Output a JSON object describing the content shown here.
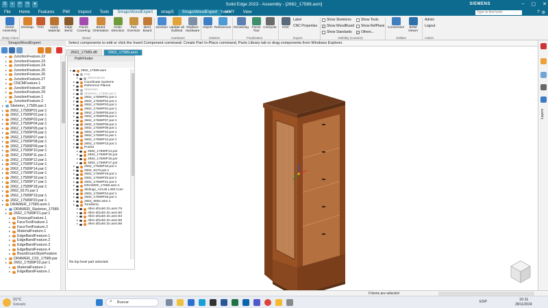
{
  "window": {
    "title": "Solid Edge 2023 - Assembly - [2662_17589.asm]",
    "brand": "SIEMENS",
    "controls": [
      "–",
      "▢",
      "✕"
    ]
  },
  "menu": {
    "tabs": [
      "File",
      "Home",
      "Features",
      "PMI",
      "Inspect",
      "Tools",
      "SmapsWoodExpert",
      "smapS",
      "SmapsWoodExpert",
      "HMY",
      "View"
    ],
    "active_index": 4,
    "token_label": "Token",
    "search_placeholder": "Type to find tools"
  },
  "ribbon": {
    "buttons": [
      {
        "label": "Clone Assembly",
        "icon": "clone-icon",
        "color": "#3a7bc8"
      },
      {
        "label": "Dressup",
        "icon": "dressup-icon",
        "color": "#d9822b"
      },
      {
        "label": "Trim",
        "icon": "trim-icon",
        "color": "#c65a2e"
      },
      {
        "label": "Apply Material",
        "icon": "material-icon",
        "color": "#b8742f"
      },
      {
        "label": "Edge Bend",
        "icon": "edge-bend-icon",
        "color": "#8b5a2b"
      },
      {
        "label": "Faces Covering",
        "icon": "faces-covering-icon",
        "color": "#a44bb0"
      },
      {
        "label": "Board Orientation",
        "icon": "board-orientation-icon",
        "color": "#d08a3a"
      },
      {
        "label": "Grain Direction",
        "icon": "grain-direction-icon",
        "color": "#6f9a3b"
      },
      {
        "label": "Part Oversize",
        "icon": "part-oversize-icon",
        "color": "#c9923e"
      },
      {
        "label": "Bent Board",
        "icon": "bent-board-icon",
        "color": "#c27a34"
      },
      {
        "label": "Junction",
        "icon": "junction-icon",
        "color": "#4a8ad0"
      },
      {
        "label": "Update all Subfeat",
        "icon": "update-icon",
        "color": "#e3a33a"
      },
      {
        "label": "Replace Hardware",
        "icon": "replace-hardware-icon",
        "color": "#7c8fa6"
      },
      {
        "label": "Import",
        "icon": "import-icon",
        "color": "#3c7fc4"
      },
      {
        "label": "References",
        "icon": "references-icon",
        "color": "#4d9ad6"
      },
      {
        "label": "Renaming",
        "icon": "renaming-icon",
        "color": "#5a7fb0"
      },
      {
        "label": "Faces Tool",
        "icon": "faces-tool-icon",
        "color": "#3d8f6c"
      },
      {
        "label": "Compute",
        "icon": "compute-icon",
        "color": "#6b6b6b"
      },
      {
        "label": "CNC",
        "icon": "cnc-icon",
        "color": "#5a6a7a"
      },
      {
        "label": "Conversion",
        "icon": "conversion-icon",
        "color": "#3f7fbf"
      },
      {
        "label": "BOM Viewer",
        "icon": "bom-viewer-icon",
        "color": "#2f6fab"
      }
    ],
    "groups": [
      "Deep Clone",
      "Wood",
      "Hardware",
      "HMSize",
      "Finalization",
      "Export",
      "Visibility (Custom)",
      "Utilities",
      "Admin"
    ],
    "export_items": [
      "Label",
      "CNC Properties"
    ],
    "checkboxes": [
      {
        "label": "Show Skeletons",
        "checked": false
      },
      {
        "label": "Show WoodBoard",
        "checked": true
      },
      {
        "label": "Show Standards",
        "checked": false
      },
      {
        "label": "Show Tools",
        "checked": false
      },
      {
        "label": "Show RefPlane",
        "checked": false
      },
      {
        "label": "Others...",
        "checked": true
      }
    ],
    "admin_label": "Admin",
    "logout_label": "Logout"
  },
  "prompt_text": "Select components to edit or click the Insert Component command. Create Part In-Place command, Parts Library tab or drag components from Windows Explorer.",
  "left_panel": {
    "title": "SmapsWoodExpert",
    "items": [
      {
        "label": "JunctionFeature.22",
        "indent": 1,
        "kind": "o"
      },
      {
        "label": "JunctionFeature.23",
        "indent": 1,
        "kind": "o"
      },
      {
        "label": "JunctionFeature.24",
        "indent": 1,
        "kind": "o"
      },
      {
        "label": "JunctionFeature.25",
        "indent": 1,
        "kind": "o"
      },
      {
        "label": "JunctionFeature.26",
        "indent": 1,
        "kind": "o"
      },
      {
        "label": "JunctionFeature.27",
        "indent": 1,
        "kind": "o"
      },
      {
        "label": "CNCMFeature.1",
        "indent": 1,
        "kind": "o"
      },
      {
        "label": "JunctionFeature.28",
        "indent": 1,
        "kind": "o"
      },
      {
        "label": "JunctionFeature.29",
        "indent": 1,
        "kind": "o"
      },
      {
        "label": "JunctionFeature.1",
        "indent": 1,
        "kind": "o"
      },
      {
        "label": "JunctionFeature.2",
        "indent": 1,
        "kind": "o"
      },
      {
        "label": "Skeleton_17589.par:1",
        "indent": 0,
        "kind": "b"
      },
      {
        "label": "2662_17589P01.par:1",
        "indent": 0,
        "kind": "o"
      },
      {
        "label": "2662_17589P02.par:1",
        "indent": 0,
        "kind": "o"
      },
      {
        "label": "2662_17589P03.par:1",
        "indent": 0,
        "kind": "o"
      },
      {
        "label": "2662_17589P04.par:1",
        "indent": 0,
        "kind": "o"
      },
      {
        "label": "2662_17589P05.par:1",
        "indent": 0,
        "kind": "o"
      },
      {
        "label": "2662_17589P06.par:1",
        "indent": 0,
        "kind": "o"
      },
      {
        "label": "2662_17589P07.par:1",
        "indent": 0,
        "kind": "o"
      },
      {
        "label": "2662_17589P08.par:1",
        "indent": 0,
        "kind": "o"
      },
      {
        "label": "2662_17589P09.par:1",
        "indent": 0,
        "kind": "o"
      },
      {
        "label": "2662_17589P10.par:1",
        "indent": 0,
        "kind": "o"
      },
      {
        "label": "2662_17589P11.par:1",
        "indent": 0,
        "kind": "o"
      },
      {
        "label": "2662_17589P12.par:1",
        "indent": 0,
        "kind": "o"
      },
      {
        "label": "2662_17589P13.par:1",
        "indent": 0,
        "kind": "o"
      },
      {
        "label": "2662_17589P14.par:1",
        "indent": 0,
        "kind": "o"
      },
      {
        "label": "2662_17589P15.par:1",
        "indent": 0,
        "kind": "o"
      },
      {
        "label": "2662_17589P16.par:1",
        "indent": 0,
        "kind": "o"
      },
      {
        "label": "2662_17589P17.par:1",
        "indent": 0,
        "kind": "o"
      },
      {
        "label": "2662_17589P18.par:1",
        "indent": 0,
        "kind": "o"
      },
      {
        "label": "2662_8170.par:1",
        "indent": 0,
        "kind": "o"
      },
      {
        "label": "2662_17589P19.par:1",
        "indent": 0,
        "kind": "o"
      },
      {
        "label": "2662_17589P20.par:1",
        "indent": 0,
        "kind": "o"
      },
      {
        "label": "DRAWER_17589.asm:1",
        "indent": 0,
        "kind": "o"
      },
      {
        "label": "DRAWER_Skeleton_17589",
        "indent": 1,
        "kind": "b"
      },
      {
        "label": "2662_17589P21.par:1",
        "indent": 1,
        "kind": "o"
      },
      {
        "label": "DressupFeature.1",
        "indent": 2,
        "kind": "o"
      },
      {
        "label": "FaceToolFeature.1",
        "indent": 2,
        "kind": "o"
      },
      {
        "label": "FaceToolFeature.2",
        "indent": 2,
        "kind": "o"
      },
      {
        "label": "MaterialFeature.1",
        "indent": 2,
        "kind": "o"
      },
      {
        "label": "EdgeBandFeature.1",
        "indent": 2,
        "kind": "o"
      },
      {
        "label": "EdgeBandFeature.2",
        "indent": 2,
        "kind": "o"
      },
      {
        "label": "EdgeBandFeature.3",
        "indent": 2,
        "kind": "o"
      },
      {
        "label": "EdgeBandFeature.4",
        "indent": 2,
        "kind": "o"
      },
      {
        "label": "BoardGrainStyleFeature",
        "indent": 2,
        "kind": "o"
      },
      {
        "label": "DRAWER_C02_17589.par",
        "indent": 1,
        "kind": "o"
      },
      {
        "label": "2662_17589P22.par:1",
        "indent": 1,
        "kind": "o"
      },
      {
        "label": "MaterialFeature.1",
        "indent": 2,
        "kind": "o"
      },
      {
        "label": "EdgeBandFeature.1",
        "indent": 2,
        "kind": "o"
      }
    ]
  },
  "doc_tabs": [
    "2662_17589.dft",
    "2662_17589.asm"
  ],
  "pathfinder": {
    "title": "PathFinder",
    "items": [
      {
        "label": "2662_17589.asm",
        "indent": 0
      },
      {
        "label": "PMI",
        "indent": 1,
        "gray": true
      },
      {
        "label": "Dimensions",
        "indent": 2,
        "gray": true
      },
      {
        "label": "Coordinate Systems",
        "indent": 1,
        "gray": false
      },
      {
        "label": "Reference Planes",
        "indent": 1,
        "gray": false
      },
      {
        "label": "Sketches",
        "indent": 1,
        "gray": true
      },
      {
        "label": "Skeleton_17589.par:1",
        "indent": 1,
        "gray": true
      },
      {
        "label": "2662_17589P01.par:1",
        "indent": 1
      },
      {
        "label": "2662_17589P02.par:1",
        "indent": 1
      },
      {
        "label": "2662_17589P03.par:1",
        "indent": 1
      },
      {
        "label": "2662_17589P04.par:1",
        "indent": 1
      },
      {
        "label": "2662_17589P05.par:1",
        "indent": 1
      },
      {
        "label": "2662_17589P06.par:1",
        "indent": 1
      },
      {
        "label": "2662_17589P07.par:1",
        "indent": 1
      },
      {
        "label": "2662_17589P08.par:1",
        "indent": 1
      },
      {
        "label": "2662_17589P09.par:1",
        "indent": 1
      },
      {
        "label": "2662_17589P10.par:1",
        "indent": 1
      },
      {
        "label": "2662_17589P11.par:1",
        "indent": 1
      },
      {
        "label": "2662_17589P12.par:1",
        "indent": 1
      },
      {
        "label": "2662_17589P13.par:1",
        "indent": 1
      },
      {
        "label": "Puerta",
        "indent": 1
      },
      {
        "label": "2662_17589P14.par",
        "indent": 2
      },
      {
        "label": "2662_17589P15.par",
        "indent": 2
      },
      {
        "label": "2662_17589P16.par",
        "indent": 2
      },
      {
        "label": "2662_17589P17.par",
        "indent": 2
      },
      {
        "label": "2662_17589P18.par:1",
        "indent": 1
      },
      {
        "label": "2662_8170.par:1",
        "indent": 1
      },
      {
        "label": "2662_17589P19.par:1",
        "indent": 1
      },
      {
        "label": "2662_17589P20.par:1",
        "indent": 1
      },
      {
        "label": "2662_17589P21.par:2",
        "indent": 1
      },
      {
        "label": "DRAWER_17589.asm:1",
        "indent": 1
      },
      {
        "label": "Slidings_A2128.L450.Com",
        "indent": 1
      },
      {
        "label": "2662_17589P24.par:1",
        "indent": 1
      },
      {
        "label": "2662_17589P25.par:1",
        "indent": 1
      },
      {
        "label": "2662_9082.asm:1",
        "indent": 1
      },
      {
        "label": "Tornillería",
        "indent": 1
      },
      {
        "label": "Allen Ø1x50 Zn.asm:79",
        "indent": 2
      },
      {
        "label": "Allen Ø1x50 Zn.asm:80",
        "indent": 2
      },
      {
        "label": "Allen Ø1x50 Zn.asm:83",
        "indent": 2
      },
      {
        "label": "Allen Ø1x50 Zn.asm:85",
        "indent": 2
      },
      {
        "label": "Allen Ø1x50 Zn.asm:88",
        "indent": 2
      }
    ],
    "status": "No top level part selected."
  },
  "right_panel": {
    "label": "Layers"
  },
  "statusbar": {
    "items_selected": "0 items are selected"
  },
  "taskbar": {
    "weather_temp": "21°C",
    "weather_desc": "Soleado",
    "search_label": "Buscar",
    "language": "ESP",
    "time": "10:11",
    "date": "28/11/2024",
    "apps": [
      "windows-start-icon",
      "search-icon",
      "file-explorer-icon",
      "edge-browser-icon",
      "store-icon",
      "solid-edge-icon",
      "word-icon",
      "excel-icon",
      "outlook-icon",
      "teams-icon",
      "chrome-icon",
      "folder-icon",
      "settings-icon"
    ]
  }
}
